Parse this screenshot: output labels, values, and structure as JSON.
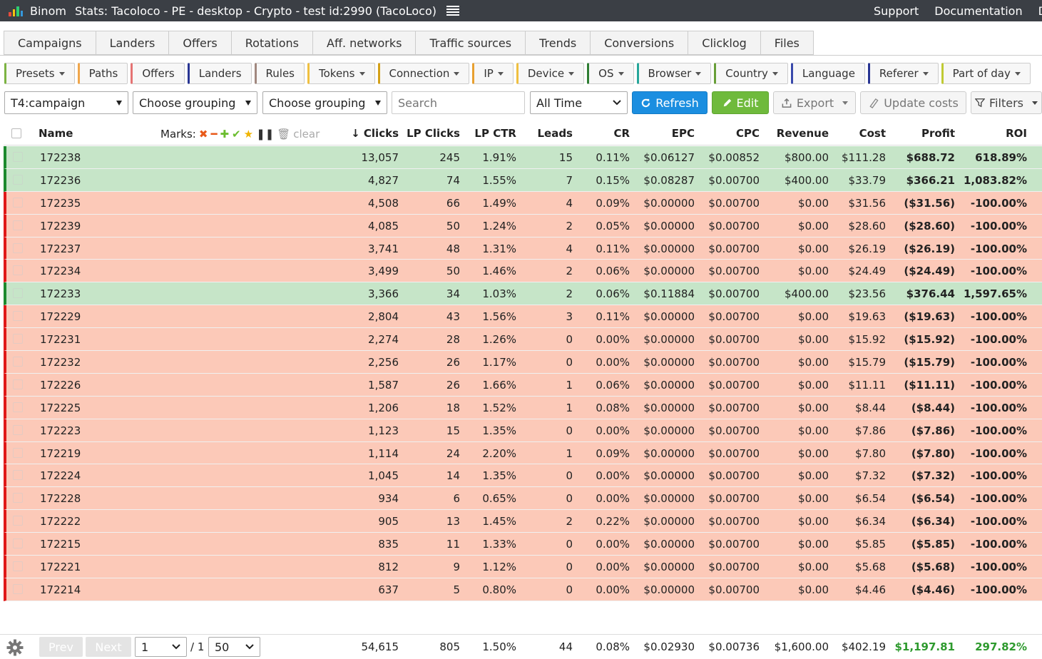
{
  "header": {
    "brand": "Binom",
    "title": "Stats: Tacoloco - PE - desktop - Crypto - test id:2990 (TacoLoco)",
    "support": "Support",
    "documentation": "Documentation",
    "cut_link": "D"
  },
  "tabs": [
    "Campaigns",
    "Landers",
    "Offers",
    "Rotations",
    "Aff. networks",
    "Traffic sources",
    "Trends",
    "Conversions",
    "Clicklog",
    "Files"
  ],
  "groups": [
    {
      "label": "Presets",
      "dropdown": true,
      "color": "#7cb342"
    },
    {
      "label": "Paths",
      "dropdown": false,
      "color": "#f0a64b"
    },
    {
      "label": "Offers",
      "dropdown": false,
      "color": "#e57373"
    },
    {
      "label": "Landers",
      "dropdown": false,
      "color": "#283593"
    },
    {
      "label": "Rules",
      "dropdown": false,
      "color": "#a1887f"
    },
    {
      "label": "Tokens",
      "dropdown": true,
      "color": "#f0c040"
    },
    {
      "label": "Connection",
      "dropdown": true,
      "color": "#d4a017"
    },
    {
      "label": "IP",
      "dropdown": true,
      "color": "#e8a030"
    },
    {
      "label": "Device",
      "dropdown": true,
      "color": "#f0c040"
    },
    {
      "label": "OS",
      "dropdown": true,
      "color": "#2e7d32"
    },
    {
      "label": "Browser",
      "dropdown": true,
      "color": "#26a69a"
    },
    {
      "label": "Country",
      "dropdown": true,
      "color": "#689f38"
    },
    {
      "label": "Language",
      "dropdown": false,
      "color": "#3949ab"
    },
    {
      "label": "Referer",
      "dropdown": true,
      "color": "#283593"
    },
    {
      "label": "Part of day",
      "dropdown": true,
      "color": "#c0ca33"
    }
  ],
  "filters": {
    "grouping1": "T4:campaign",
    "grouping2": "Choose grouping",
    "grouping3": "Choose grouping",
    "search_placeholder": "Search",
    "period": "All Time",
    "refresh": "Refresh",
    "edit": "Edit",
    "export": "Export",
    "update_costs": "Update costs",
    "filters": "Filters"
  },
  "columns": {
    "name": "Name",
    "marks": "Marks:",
    "clear": "clear",
    "clicks": "Clicks",
    "lp_clicks": "LP Clicks",
    "lp_ctr": "LP CTR",
    "leads": "Leads",
    "cr": "CR",
    "epc": "EPC",
    "cpc": "CPC",
    "revenue": "Revenue",
    "cost": "Cost",
    "profit": "Profit",
    "roi": "ROI"
  },
  "rows": [
    {
      "status": "win",
      "name": "172238",
      "clicks": "13,057",
      "lp_clicks": "245",
      "lp_ctr": "1.91%",
      "leads": "15",
      "cr": "0.11%",
      "epc": "$0.06127",
      "cpc": "$0.00852",
      "revenue": "$800.00",
      "cost": "$111.28",
      "profit": "$688.72",
      "roi": "618.89%"
    },
    {
      "status": "win",
      "name": "172236",
      "clicks": "4,827",
      "lp_clicks": "74",
      "lp_ctr": "1.55%",
      "leads": "7",
      "cr": "0.15%",
      "epc": "$0.08287",
      "cpc": "$0.00700",
      "revenue": "$400.00",
      "cost": "$33.79",
      "profit": "$366.21",
      "roi": "1,083.82%"
    },
    {
      "status": "lose",
      "name": "172235",
      "clicks": "4,508",
      "lp_clicks": "66",
      "lp_ctr": "1.49%",
      "leads": "4",
      "cr": "0.09%",
      "epc": "$0.00000",
      "cpc": "$0.00700",
      "revenue": "$0.00",
      "cost": "$31.56",
      "profit": "($31.56)",
      "roi": "-100.00%"
    },
    {
      "status": "lose",
      "name": "172239",
      "clicks": "4,085",
      "lp_clicks": "50",
      "lp_ctr": "1.24%",
      "leads": "2",
      "cr": "0.05%",
      "epc": "$0.00000",
      "cpc": "$0.00700",
      "revenue": "$0.00",
      "cost": "$28.60",
      "profit": "($28.60)",
      "roi": "-100.00%"
    },
    {
      "status": "lose",
      "name": "172237",
      "clicks": "3,741",
      "lp_clicks": "48",
      "lp_ctr": "1.31%",
      "leads": "4",
      "cr": "0.11%",
      "epc": "$0.00000",
      "cpc": "$0.00700",
      "revenue": "$0.00",
      "cost": "$26.19",
      "profit": "($26.19)",
      "roi": "-100.00%"
    },
    {
      "status": "lose",
      "name": "172234",
      "clicks": "3,499",
      "lp_clicks": "50",
      "lp_ctr": "1.46%",
      "leads": "2",
      "cr": "0.06%",
      "epc": "$0.00000",
      "cpc": "$0.00700",
      "revenue": "$0.00",
      "cost": "$24.49",
      "profit": "($24.49)",
      "roi": "-100.00%"
    },
    {
      "status": "win",
      "name": "172233",
      "clicks": "3,366",
      "lp_clicks": "34",
      "lp_ctr": "1.03%",
      "leads": "2",
      "cr": "0.06%",
      "epc": "$0.11884",
      "cpc": "$0.00700",
      "revenue": "$400.00",
      "cost": "$23.56",
      "profit": "$376.44",
      "roi": "1,597.65%"
    },
    {
      "status": "lose",
      "name": "172229",
      "clicks": "2,804",
      "lp_clicks": "43",
      "lp_ctr": "1.56%",
      "leads": "3",
      "cr": "0.11%",
      "epc": "$0.00000",
      "cpc": "$0.00700",
      "revenue": "$0.00",
      "cost": "$19.63",
      "profit": "($19.63)",
      "roi": "-100.00%"
    },
    {
      "status": "lose",
      "name": "172231",
      "clicks": "2,274",
      "lp_clicks": "28",
      "lp_ctr": "1.26%",
      "leads": "0",
      "cr": "0.00%",
      "epc": "$0.00000",
      "cpc": "$0.00700",
      "revenue": "$0.00",
      "cost": "$15.92",
      "profit": "($15.92)",
      "roi": "-100.00%"
    },
    {
      "status": "lose",
      "name": "172232",
      "clicks": "2,256",
      "lp_clicks": "26",
      "lp_ctr": "1.17%",
      "leads": "0",
      "cr": "0.00%",
      "epc": "$0.00000",
      "cpc": "$0.00700",
      "revenue": "$0.00",
      "cost": "$15.79",
      "profit": "($15.79)",
      "roi": "-100.00%"
    },
    {
      "status": "lose",
      "name": "172226",
      "clicks": "1,587",
      "lp_clicks": "26",
      "lp_ctr": "1.66%",
      "leads": "1",
      "cr": "0.06%",
      "epc": "$0.00000",
      "cpc": "$0.00700",
      "revenue": "$0.00",
      "cost": "$11.11",
      "profit": "($11.11)",
      "roi": "-100.00%"
    },
    {
      "status": "lose",
      "name": "172225",
      "clicks": "1,206",
      "lp_clicks": "18",
      "lp_ctr": "1.52%",
      "leads": "1",
      "cr": "0.08%",
      "epc": "$0.00000",
      "cpc": "$0.00700",
      "revenue": "$0.00",
      "cost": "$8.44",
      "profit": "($8.44)",
      "roi": "-100.00%"
    },
    {
      "status": "lose",
      "name": "172223",
      "clicks": "1,123",
      "lp_clicks": "15",
      "lp_ctr": "1.35%",
      "leads": "0",
      "cr": "0.00%",
      "epc": "$0.00000",
      "cpc": "$0.00700",
      "revenue": "$0.00",
      "cost": "$7.86",
      "profit": "($7.86)",
      "roi": "-100.00%"
    },
    {
      "status": "lose",
      "name": "172219",
      "clicks": "1,114",
      "lp_clicks": "24",
      "lp_ctr": "2.20%",
      "leads": "1",
      "cr": "0.09%",
      "epc": "$0.00000",
      "cpc": "$0.00700",
      "revenue": "$0.00",
      "cost": "$7.80",
      "profit": "($7.80)",
      "roi": "-100.00%"
    },
    {
      "status": "lose",
      "name": "172224",
      "clicks": "1,045",
      "lp_clicks": "14",
      "lp_ctr": "1.35%",
      "leads": "0",
      "cr": "0.00%",
      "epc": "$0.00000",
      "cpc": "$0.00700",
      "revenue": "$0.00",
      "cost": "$7.32",
      "profit": "($7.32)",
      "roi": "-100.00%"
    },
    {
      "status": "lose",
      "name": "172228",
      "clicks": "934",
      "lp_clicks": "6",
      "lp_ctr": "0.65%",
      "leads": "0",
      "cr": "0.00%",
      "epc": "$0.00000",
      "cpc": "$0.00700",
      "revenue": "$0.00",
      "cost": "$6.54",
      "profit": "($6.54)",
      "roi": "-100.00%"
    },
    {
      "status": "lose",
      "name": "172222",
      "clicks": "905",
      "lp_clicks": "13",
      "lp_ctr": "1.45%",
      "leads": "2",
      "cr": "0.22%",
      "epc": "$0.00000",
      "cpc": "$0.00700",
      "revenue": "$0.00",
      "cost": "$6.34",
      "profit": "($6.34)",
      "roi": "-100.00%"
    },
    {
      "status": "lose",
      "name": "172215",
      "clicks": "835",
      "lp_clicks": "11",
      "lp_ctr": "1.33%",
      "leads": "0",
      "cr": "0.00%",
      "epc": "$0.00000",
      "cpc": "$0.00700",
      "revenue": "$0.00",
      "cost": "$5.85",
      "profit": "($5.85)",
      "roi": "-100.00%"
    },
    {
      "status": "lose",
      "name": "172221",
      "clicks": "812",
      "lp_clicks": "9",
      "lp_ctr": "1.12%",
      "leads": "0",
      "cr": "0.00%",
      "epc": "$0.00000",
      "cpc": "$0.00700",
      "revenue": "$0.00",
      "cost": "$5.68",
      "profit": "($5.68)",
      "roi": "-100.00%"
    },
    {
      "status": "lose",
      "name": "172214",
      "clicks": "637",
      "lp_clicks": "5",
      "lp_ctr": "0.80%",
      "leads": "0",
      "cr": "0.00%",
      "epc": "$0.00000",
      "cpc": "$0.00700",
      "revenue": "$0.00",
      "cost": "$4.46",
      "profit": "($4.46)",
      "roi": "-100.00%"
    }
  ],
  "footer": {
    "prev": "Prev",
    "next": "Next",
    "page": "1",
    "pages": "/ 1",
    "per_page": "50",
    "clicks": "54,615",
    "lp_clicks": "805",
    "lp_ctr": "1.50%",
    "leads": "44",
    "cr": "0.08%",
    "epc": "$0.02930",
    "cpc": "$0.00736",
    "revenue": "$1,600.00",
    "cost": "$402.19",
    "profit": "$1,197.81",
    "roi": "297.82%"
  },
  "colors": {
    "win_row": "#c6e5c8",
    "lose_row": "#fcc9b8",
    "positive": "#2e9a2e",
    "negative": "#d4262f"
  },
  "icons": [
    "menu-icon",
    "sort-down-icon",
    "mark-x-icon",
    "mark-minus-icon",
    "mark-plus-icon",
    "mark-check-icon",
    "mark-star-icon",
    "mark-pause-icon",
    "trash-icon",
    "refresh-icon",
    "pencil-icon",
    "export-icon",
    "money-icon",
    "filter-icon",
    "gear-icon"
  ]
}
